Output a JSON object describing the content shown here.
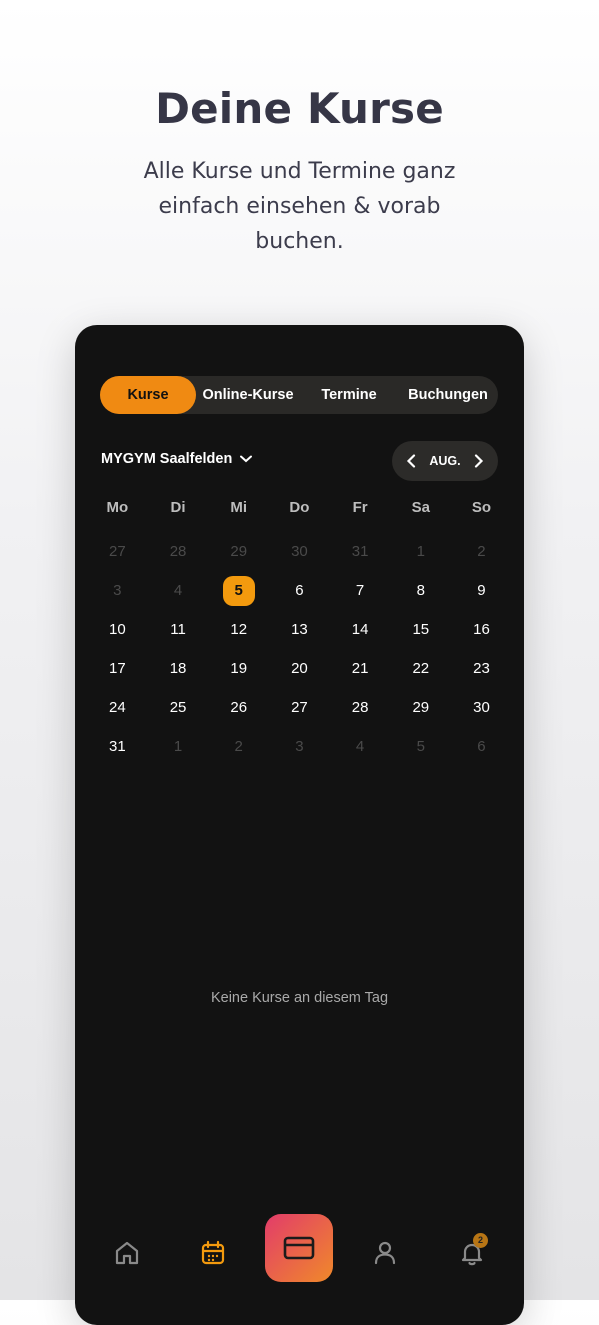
{
  "hero": {
    "title": "Deine Kurse",
    "subtitle": "Alle Kurse und Termine ganz einfach einsehen & vorab buchen."
  },
  "tabs": [
    {
      "label": "Kurse",
      "active": true
    },
    {
      "label": "Online-Kurse",
      "active": false
    },
    {
      "label": "Termine",
      "active": false
    },
    {
      "label": "Buchungen",
      "active": false
    }
  ],
  "location": {
    "label": "MYGYM Saalfelden",
    "icon": "chevron-down-icon"
  },
  "month_nav": {
    "label": "AUG.",
    "prev_icon": "chevron-left-icon",
    "next_icon": "chevron-right-icon"
  },
  "calendar": {
    "weekdays": [
      "Mo",
      "Di",
      "Mi",
      "Do",
      "Fr",
      "Sa",
      "So"
    ],
    "weeks": [
      [
        "27",
        "28",
        "29",
        "30",
        "31",
        "1",
        "2"
      ],
      [
        "3",
        "4",
        "5",
        "6",
        "7",
        "8",
        "9"
      ],
      [
        "10",
        "11",
        "12",
        "13",
        "14",
        "15",
        "16"
      ],
      [
        "17",
        "18",
        "19",
        "20",
        "21",
        "22",
        "23"
      ],
      [
        "24",
        "25",
        "26",
        "27",
        "28",
        "29",
        "30"
      ],
      [
        "31",
        "1",
        "2",
        "3",
        "4",
        "5",
        "6"
      ]
    ],
    "selected_day": "5",
    "accent_color": "#f39a0e"
  },
  "empty_state": "Keine Kurse an diesem Tag",
  "bottom_nav": {
    "items": [
      "home-icon",
      "calendar-icon",
      "card-icon",
      "user-icon",
      "bell-icon"
    ],
    "notification_count": "2"
  }
}
